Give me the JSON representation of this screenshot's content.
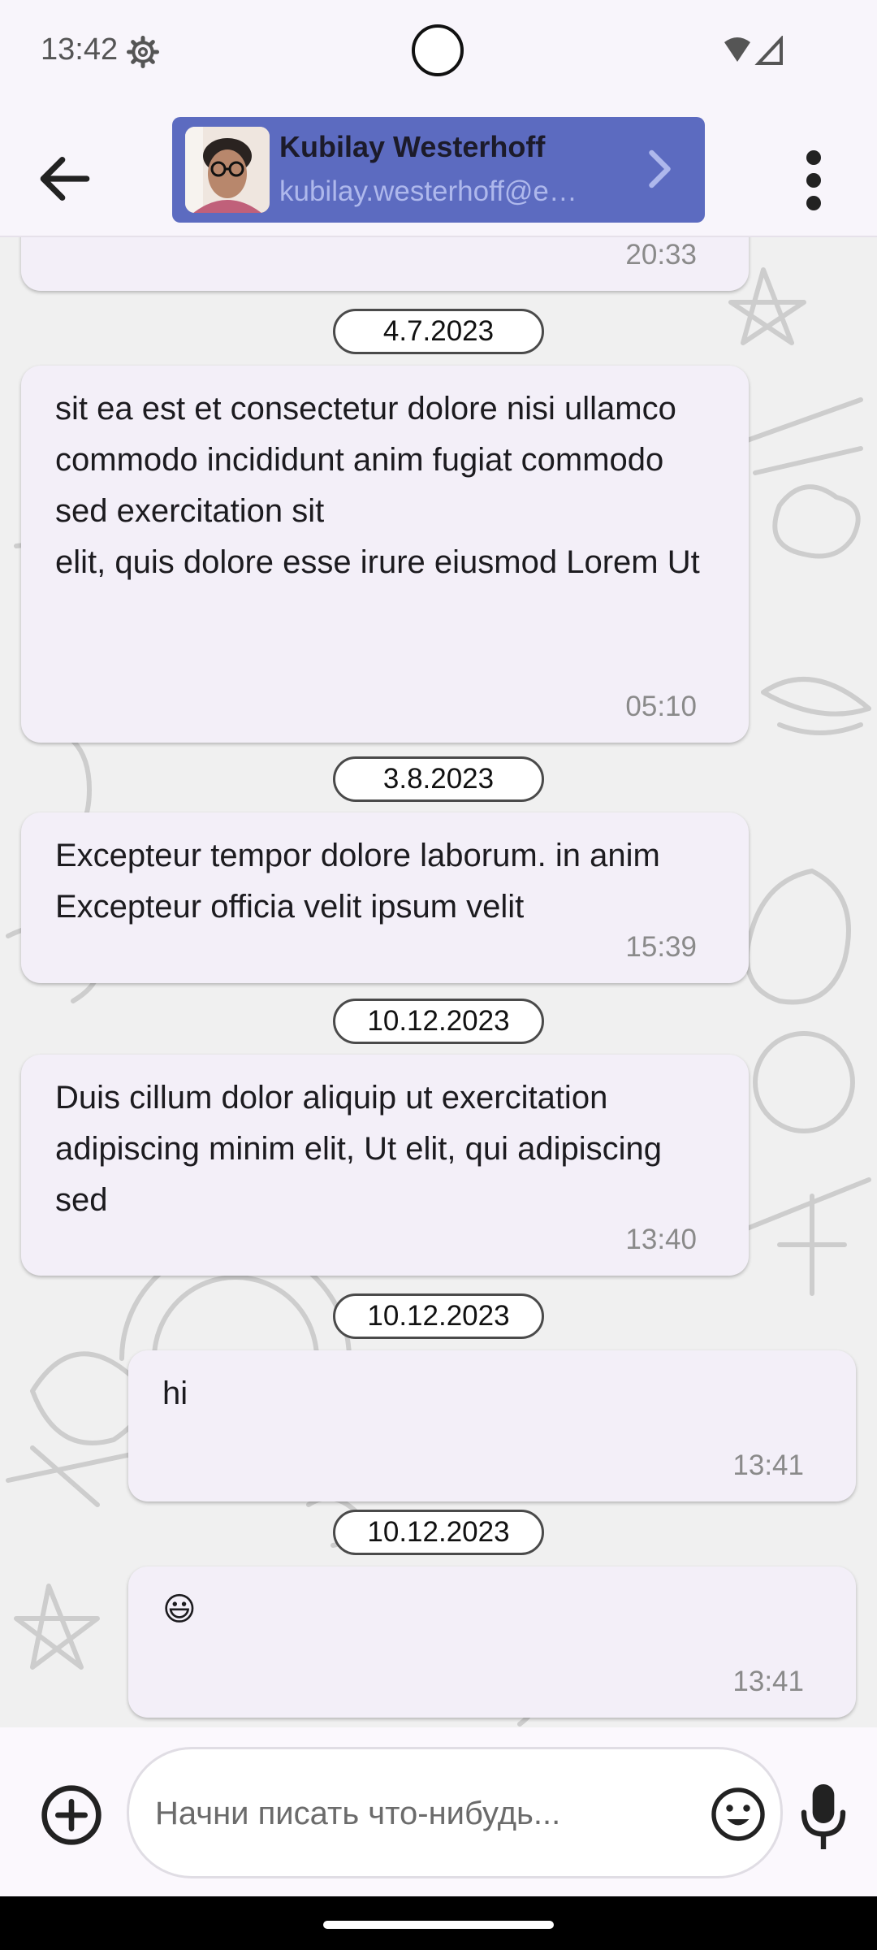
{
  "status_bar": {
    "time": "13:42"
  },
  "header": {
    "contact_name": "Kubilay Westerhoff",
    "contact_email": "kubilay.westerhoff@e…",
    "icons": {
      "back": "arrow-back-icon",
      "chevron": "chevron-right-icon",
      "menu": "more-vert-icon"
    },
    "card_color": "#5c6bc0"
  },
  "messages": [
    {
      "type": "time",
      "time": "20:33"
    },
    {
      "type": "date",
      "date": "4.7.2023"
    },
    {
      "type": "incoming",
      "text": "sit ea est et consectetur dolore nisi ullamco\ncommodo incididunt anim fugiat commodo sed exercitation sit\nelit, quis dolore esse irure eiusmod Lorem Ut",
      "time": "05:10"
    },
    {
      "type": "date",
      "date": "3.8.2023"
    },
    {
      "type": "incoming",
      "text": "Excepteur tempor dolore laborum. in anim Excepteur officia velit ipsum velit",
      "time": "15:39"
    },
    {
      "type": "date",
      "date": "10.12.2023"
    },
    {
      "type": "incoming",
      "text": "Duis cillum dolor aliquip ut exercitation adipiscing minim elit, Ut elit, qui adipiscing sed",
      "time": "13:40"
    },
    {
      "type": "date",
      "date": "10.12.2023"
    },
    {
      "type": "outgoing",
      "text": "hi",
      "time": "13:41"
    },
    {
      "type": "date",
      "date": "10.12.2023"
    },
    {
      "type": "outgoing",
      "text": "😃",
      "time": "13:41"
    }
  ],
  "composer": {
    "placeholder": "Начни писать что-нибудь...",
    "icons": {
      "add": "add-circle-icon",
      "emoji": "emoji-icon",
      "mic": "mic-icon"
    }
  }
}
